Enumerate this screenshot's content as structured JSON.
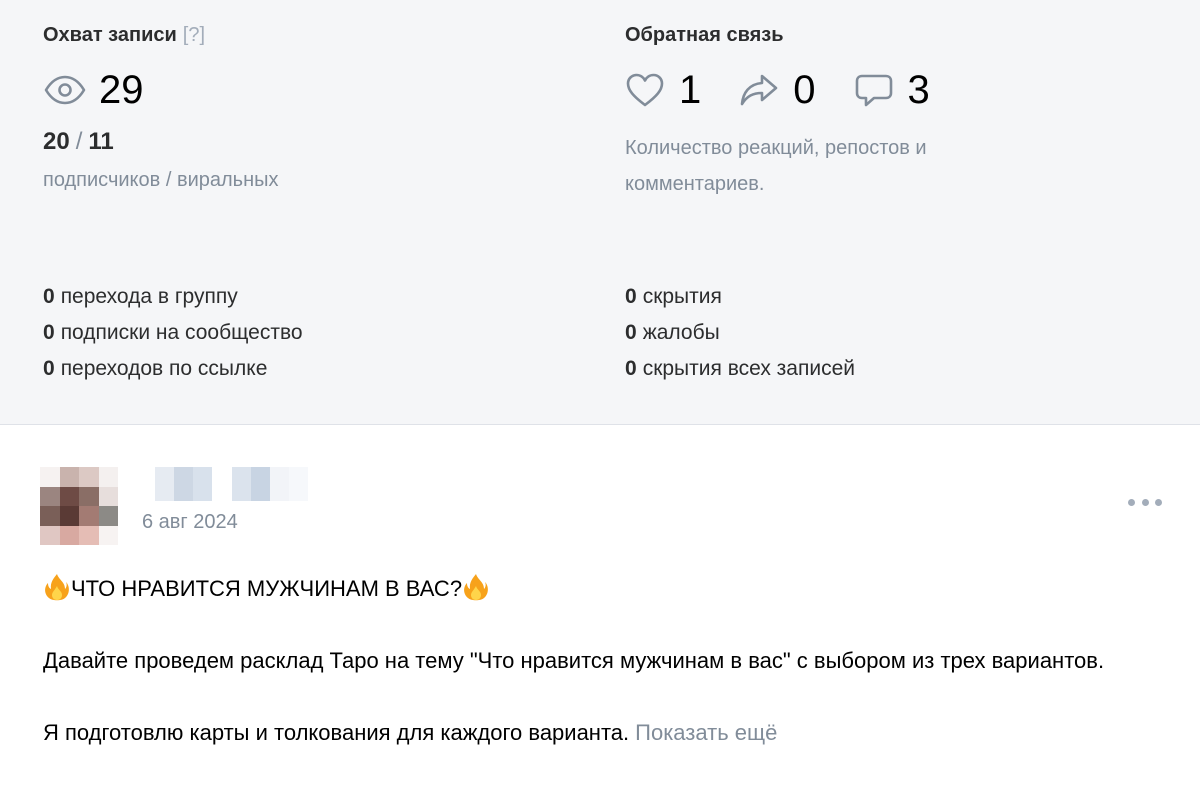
{
  "reach": {
    "title": "Охват записи",
    "help": "[?]",
    "icon": "eye-icon",
    "views": "29",
    "subscribers": "20",
    "viral": "11",
    "separator": "/",
    "caption": "подписчиков / виральных"
  },
  "feedback": {
    "title": "Обратная связь",
    "likes": "1",
    "reposts": "0",
    "comments": "3",
    "description": "Количество реакций, репостов и комментариев."
  },
  "left_facts": [
    {
      "count": "0",
      "label": "перехода в группу"
    },
    {
      "count": "0",
      "label": "подписки на сообщество"
    },
    {
      "count": "0",
      "label": "переходов по ссылке"
    }
  ],
  "right_facts": [
    {
      "count": "0",
      "label": "скрытия"
    },
    {
      "count": "0",
      "label": "жалобы"
    },
    {
      "count": "0",
      "label": "скрытия всех записей"
    }
  ],
  "post": {
    "date": "6 авг 2024",
    "headline": "ЧТО НРАВИТСЯ МУЖЧИНАМ В ВАС?",
    "paragraph1": "Давайте проведем расклад Таро на тему \"Что нравится мужчинам в вас\" с выбором из трех вариантов.",
    "paragraph2": "Я подготовлю карты и толкования для каждого варианта.",
    "show_more": "Показать ещё"
  },
  "colors": {
    "panel_bg": "#f5f6f8",
    "muted_text": "#818c99",
    "icon_gray": "#a3adba"
  }
}
